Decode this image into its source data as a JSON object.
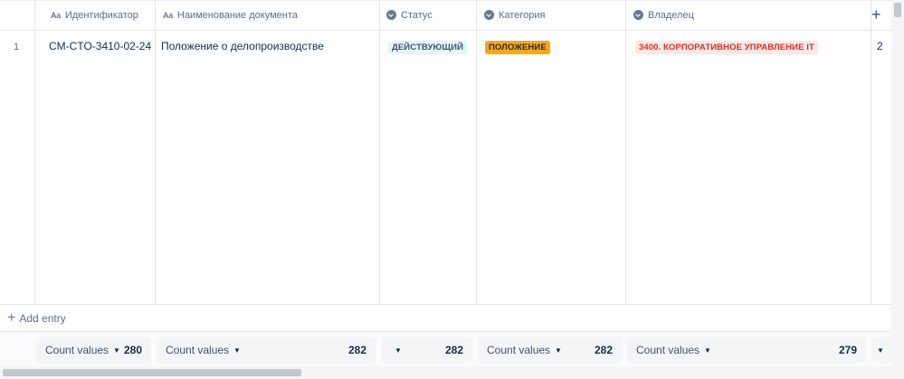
{
  "columns": [
    {
      "label": "Идентификатор",
      "icon": "text-type-icon",
      "icon_text": "Aa"
    },
    {
      "label": "Наименование документа",
      "icon": "text-type-icon",
      "icon_text": "Aa"
    },
    {
      "label": "Статус",
      "icon": "select-type-icon"
    },
    {
      "label": "Категория",
      "icon": "select-type-icon"
    },
    {
      "label": "Владелец",
      "icon": "select-type-icon"
    }
  ],
  "add_column_symbol": "+",
  "rows": [
    {
      "num": "1",
      "id": "CM-CTO-3410-02-24",
      "name": "Положение о делопроизводстве",
      "status": "ДЕЙСТВУЮЩИЙ",
      "category": "ПОЛОЖЕНИЕ",
      "owner": "3400. КОРПОРАТИВНОЕ УПРАВЛЕНИЕ IT",
      "extra": "2"
    }
  ],
  "add_entry": {
    "symbol": "+",
    "label": "Add entry"
  },
  "footer": [
    {
      "label": "Count values",
      "value": "280"
    },
    {
      "label": "Count values",
      "value": "282"
    },
    {
      "label": "",
      "value": "282"
    },
    {
      "label": "Count values",
      "value": "282"
    },
    {
      "label": "Count values",
      "value": "279"
    },
    {
      "label": "",
      "value": ""
    }
  ],
  "colors": {
    "status_tag_bg": "#e6f4fb",
    "category_tag_bg": "#f6a81d",
    "owner_tag_bg": "#fde7e5",
    "owner_tag_text": "#c9372c"
  }
}
